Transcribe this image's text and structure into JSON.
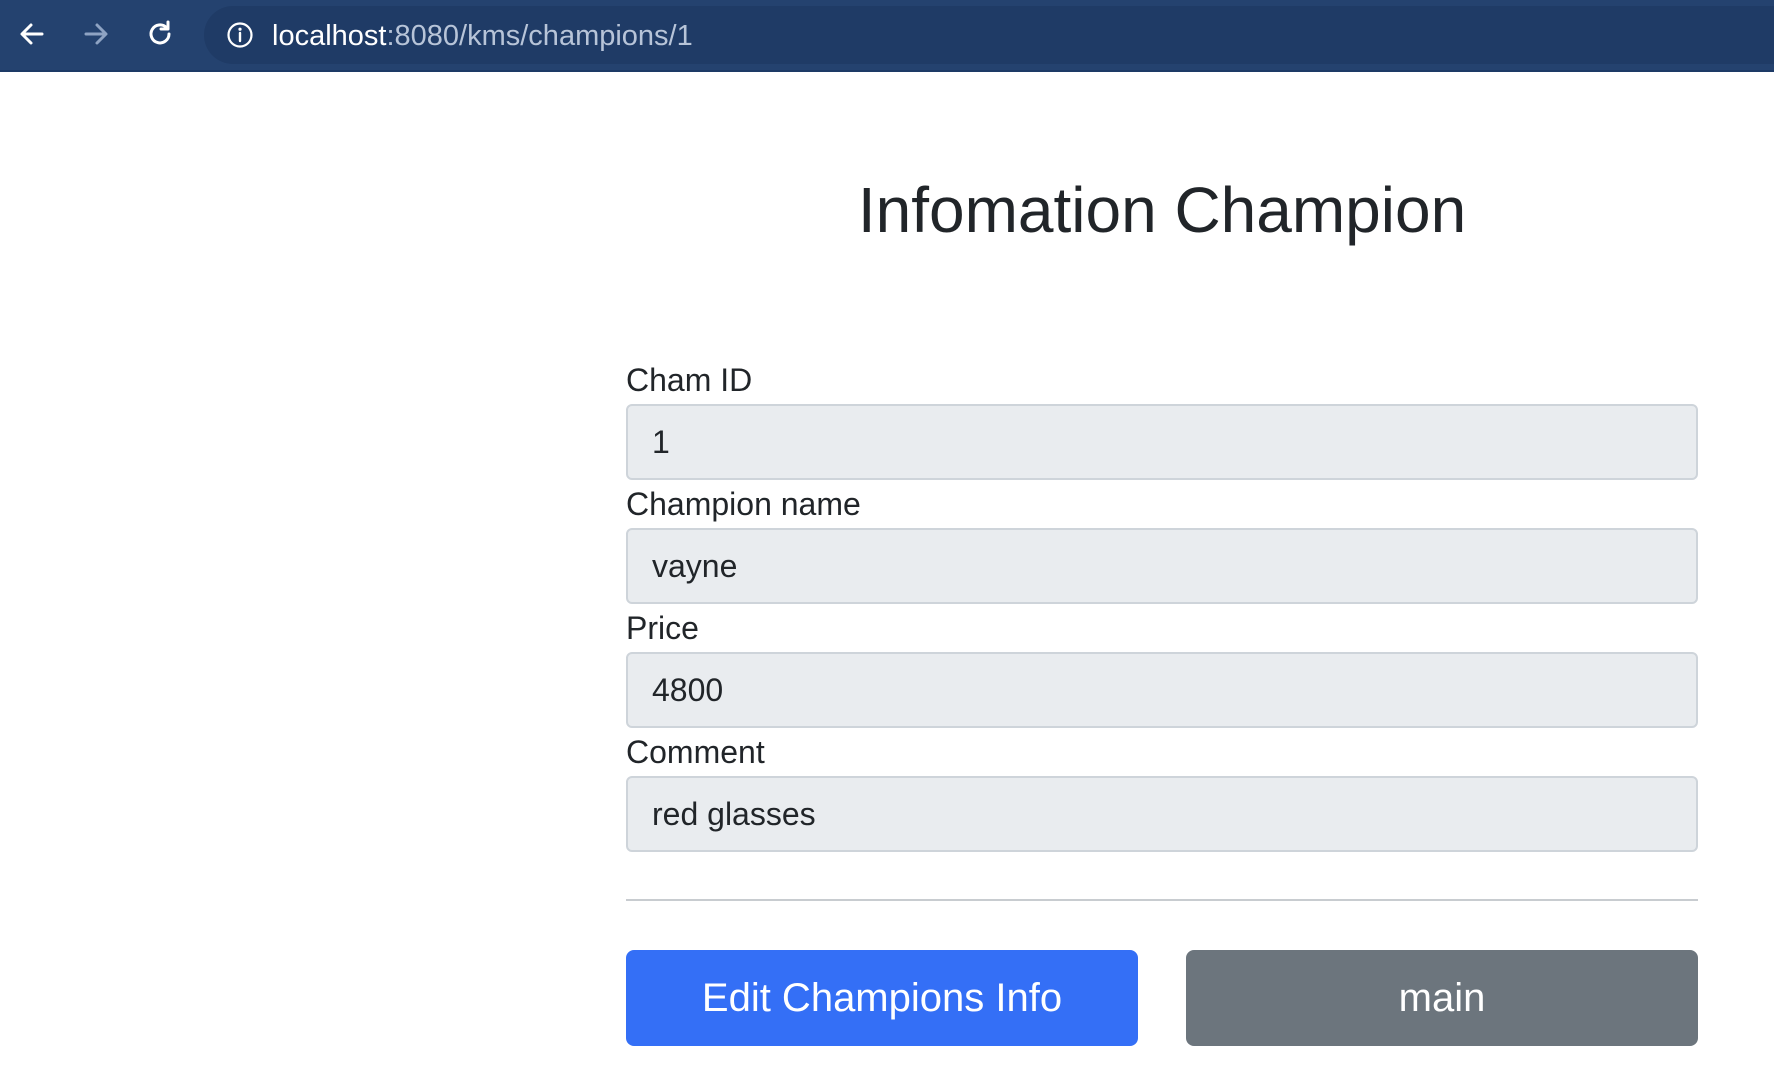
{
  "browser": {
    "url_host": "localhost",
    "url_rest": ":8080/kms/champions/1",
    "icons": {
      "back": "arrow-left-icon",
      "forward": "arrow-right-icon",
      "reload": "reload-icon",
      "info": "info-icon"
    }
  },
  "page": {
    "title": "Infomation Champion"
  },
  "form": {
    "fields": [
      {
        "label": "Cham ID",
        "value": "1"
      },
      {
        "label": "Champion name",
        "value": "vayne"
      },
      {
        "label": "Price",
        "value": "4800"
      },
      {
        "label": "Comment",
        "value": "red glasses"
      }
    ]
  },
  "actions": {
    "edit_label": "Edit Champions Info",
    "main_label": "main"
  },
  "colors": {
    "browser_bar": "#24426f",
    "primary_button": "#346ff6",
    "secondary_button": "#6c757d",
    "input_bg": "#e9ecef"
  }
}
